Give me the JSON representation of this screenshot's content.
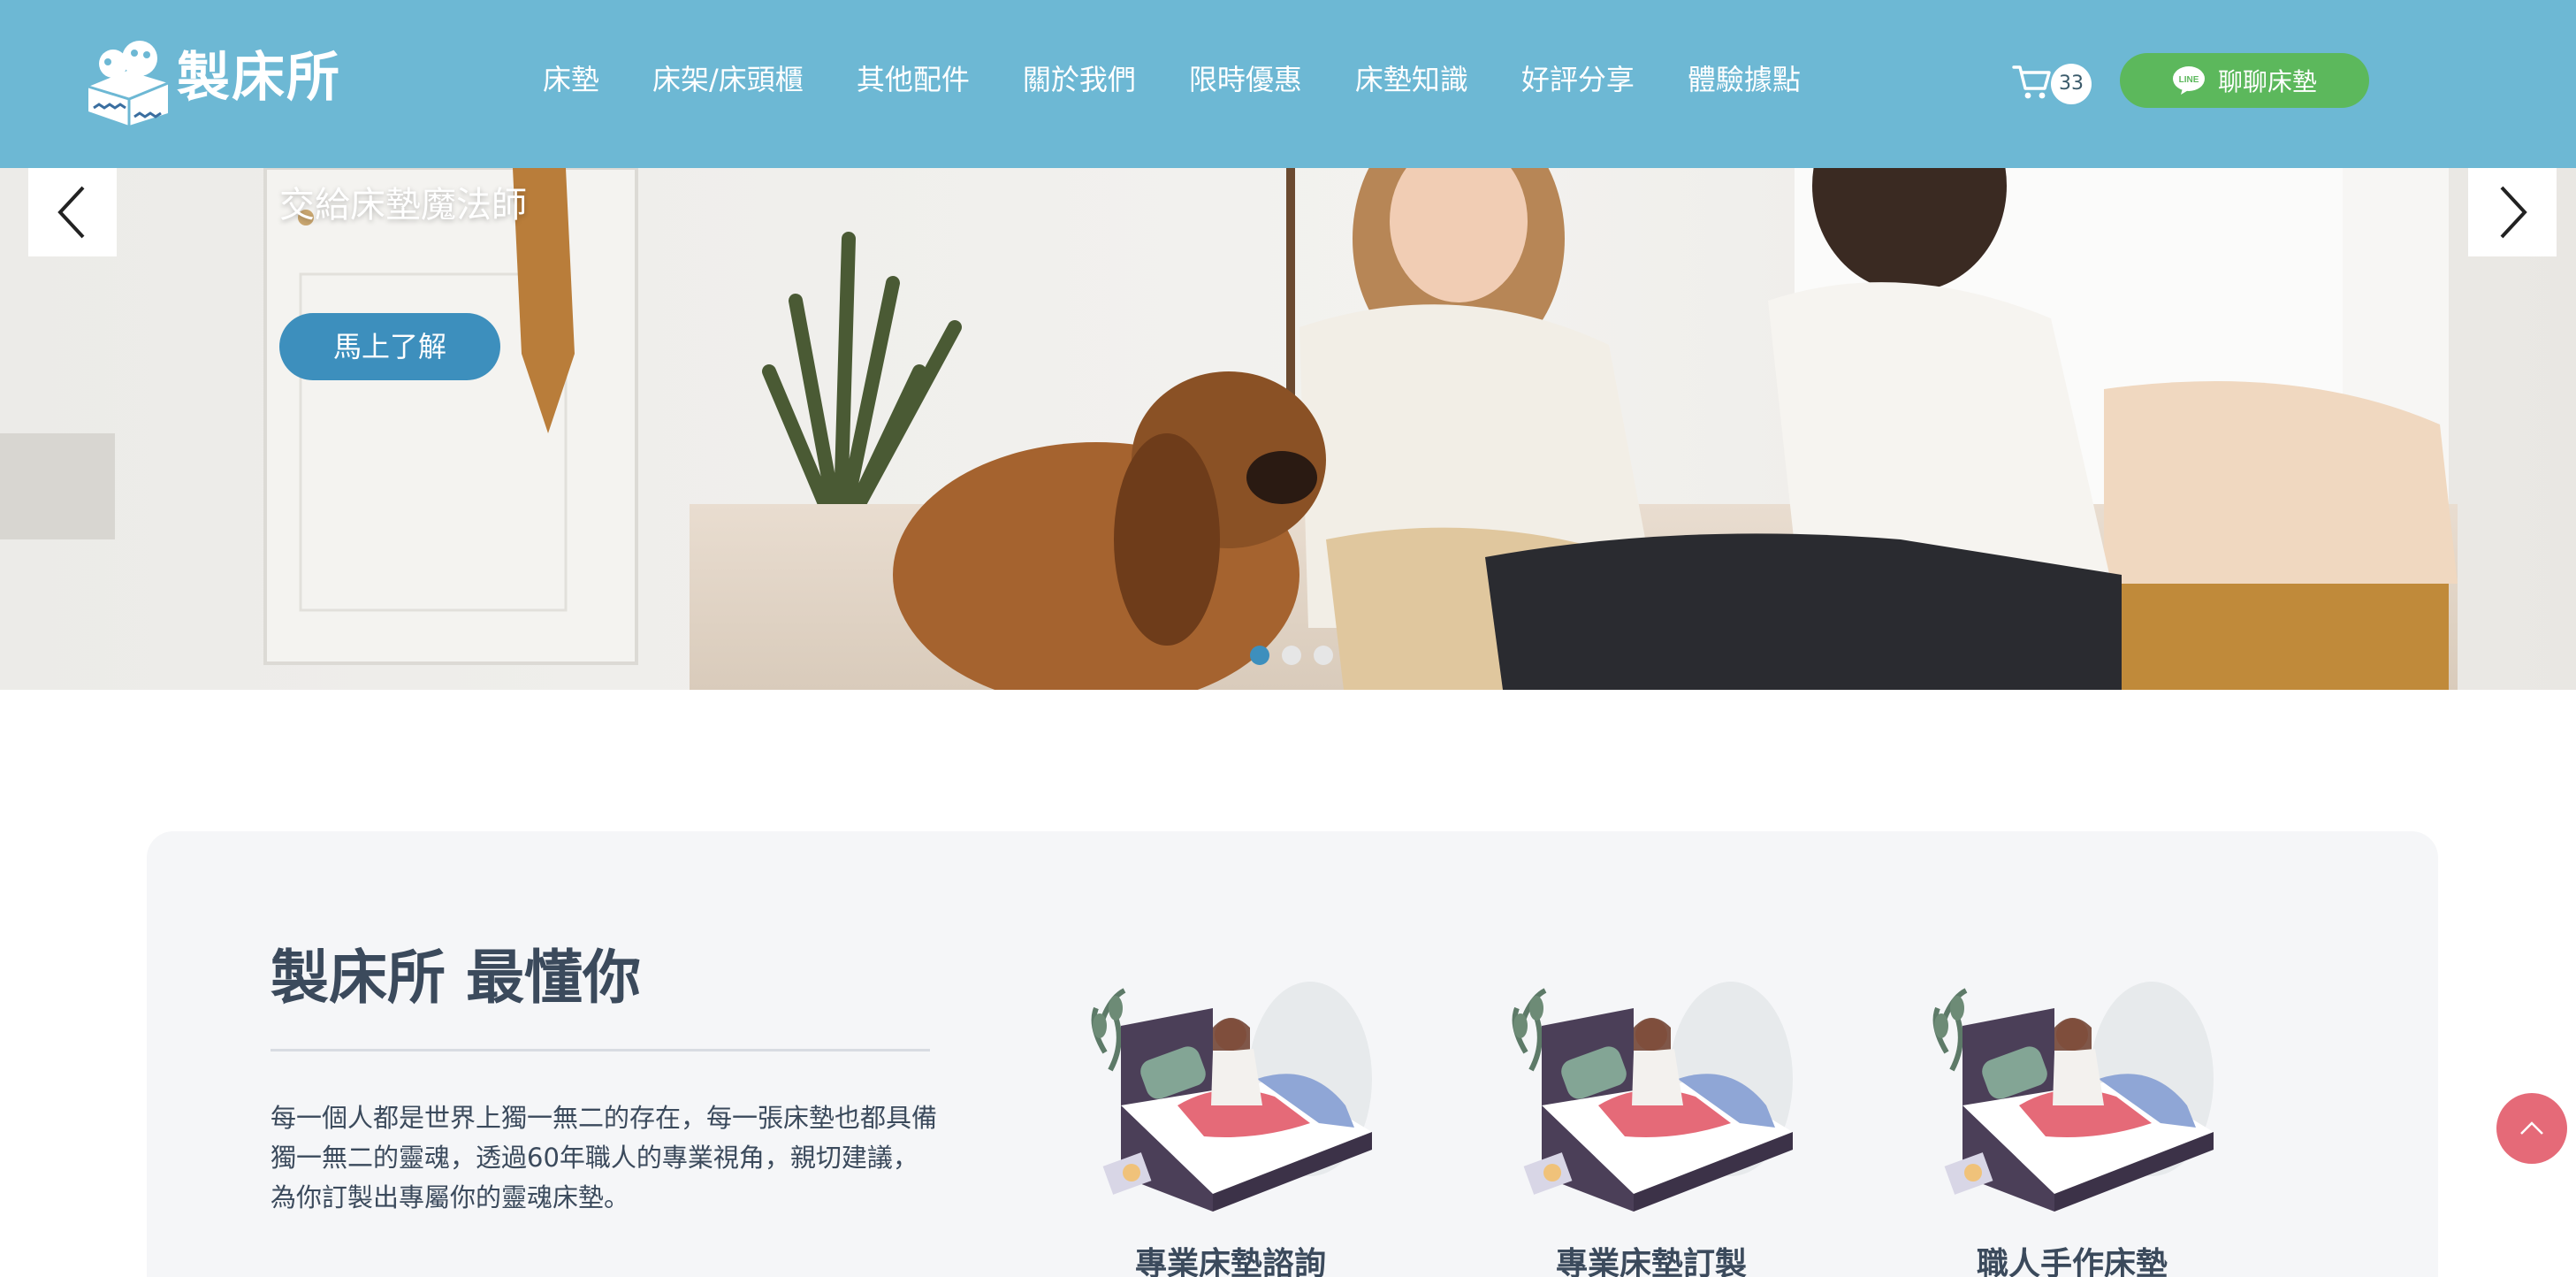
{
  "header": {
    "logo_text": "製床所",
    "nav": [
      {
        "label": "床墊"
      },
      {
        "label": "床架/床頭櫃"
      },
      {
        "label": "其他配件"
      },
      {
        "label": "關於我們"
      },
      {
        "label": "限時優惠"
      },
      {
        "label": "床墊知識"
      },
      {
        "label": "好評分享"
      },
      {
        "label": "體驗據點"
      }
    ],
    "cart_count": "33",
    "cart_icon": "cart-icon",
    "line_icon": "line-icon",
    "line_button_label": "聊聊床墊",
    "colors": {
      "bar": "#6db8d4",
      "line_button": "#5cb85c"
    }
  },
  "hero": {
    "headline": "交給床墊魔法師",
    "cta_label": "馬上了解",
    "slides_total": 3,
    "active_slide": 1,
    "prev_icon": "chevron-left-icon",
    "next_icon": "chevron-right-icon",
    "colors": {
      "cta": "#3d8fbd"
    }
  },
  "intro": {
    "title": "製床所 最懂你",
    "body": "每一個人都是世界上獨一無二的存在，每一張床墊也都具備獨一無二的靈魂，透過60年職人的專業視角，親切建議，為你訂製出專屬你的靈魂床墊。",
    "features": [
      {
        "label": "專業床墊諮詢"
      },
      {
        "label": "專業床墊訂製"
      },
      {
        "label": "職人手作床墊"
      }
    ]
  },
  "scroll_top": {
    "icon": "chevron-up-icon",
    "color": "#e56a78"
  }
}
